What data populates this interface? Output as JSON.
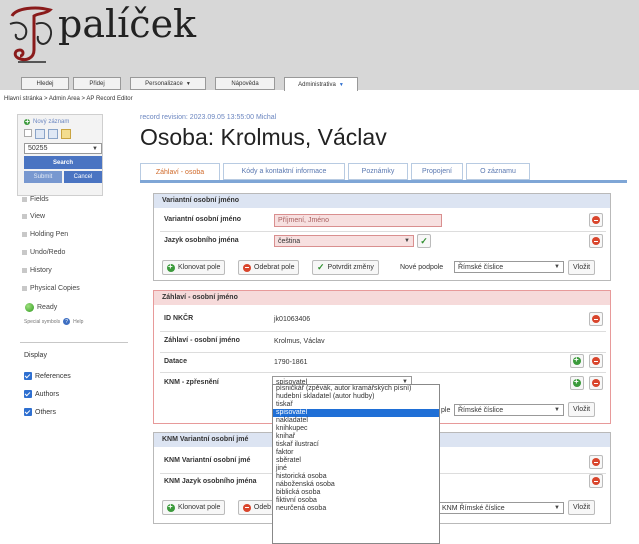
{
  "header": {
    "logo_text": "palíček",
    "nav": [
      {
        "label": "Hledej",
        "dropdown": false,
        "active": false
      },
      {
        "label": "Přidej",
        "dropdown": false,
        "active": false
      },
      {
        "label": "Personalizace",
        "dropdown": true,
        "active": false
      },
      {
        "label": "Nápověda",
        "dropdown": false,
        "active": false
      },
      {
        "label": "Administrativa",
        "dropdown": true,
        "active": true
      }
    ]
  },
  "breadcrumb": "Hlavní stránka > Admin Area > AP Record Editor",
  "left_panel": {
    "new_record": "Nový záznam",
    "record_id": "50255",
    "search_label": "Search",
    "submit_label": "Submit",
    "cancel_label": "Cancel",
    "menu": [
      "Fields",
      "View",
      "Holding Pen",
      "Undo/Redo",
      "History",
      "Physical Copies"
    ],
    "status": "Ready",
    "special_symbols": "Special symbols",
    "help": "Help",
    "display_title": "Display",
    "display_options": [
      "References",
      "Authors",
      "Others"
    ]
  },
  "main": {
    "revision": "record revision: 2023.09.05 13:55:00 Michal",
    "title": "Osoba: Krolmus, Václav",
    "tabs": [
      "Záhlaví - osoba",
      "Kódy a kontaktní informace",
      "Poznámky",
      "Propojení",
      "O záznamu"
    ],
    "variant": {
      "heading": "Variantní osobní jméno",
      "name_label": "Variantní osobní jméno",
      "name_placeholder": "Příjmení, Jméno",
      "lang_label": "Jazyk osobního jména",
      "lang_value": "čeština"
    },
    "buttons": {
      "clone": "Klonovat pole",
      "remove": "Odebrat pole",
      "confirm": "Potvrdit změny",
      "new_sub": "Nové podpole",
      "numeral": "Římské číslice",
      "insert": "Vložit"
    },
    "heading_section": {
      "heading": "Záhlaví - osobní jméno",
      "rows": [
        {
          "label": "ID NKČR",
          "value": "jk01063406"
        },
        {
          "label": "Záhlaví - osobní jméno",
          "value": "Krolmus, Václav"
        },
        {
          "label": "Datace",
          "value": "1790-1861"
        },
        {
          "label": "KNM - zpřesnění",
          "value": "spisovatel"
        }
      ],
      "podpole_text": "ple"
    },
    "knm_section": {
      "heading": "KNM Variantní osobní jmé",
      "rows": [
        "KNM Variantní osobní jmé",
        "KNM Jazyk osobního jména"
      ],
      "remove_partial": "Odeb",
      "select_value": "KNM Římské číslice"
    },
    "dropdown_options": [
      "písničkář (zpěvák, autor kramářských písní)",
      "hudební skladatel (autor hudby)",
      "tiskař",
      "spisovatel",
      "nakladatel",
      "knihkupec",
      "knihař",
      "tiskař ilustrací",
      "faktor",
      "sběratel",
      "jiné",
      "historická osoba",
      "náboženská osoba",
      "biblická osoba",
      "fiktivní osoba",
      "neurčená osoba"
    ],
    "dropdown_selected": "spisovatel"
  }
}
